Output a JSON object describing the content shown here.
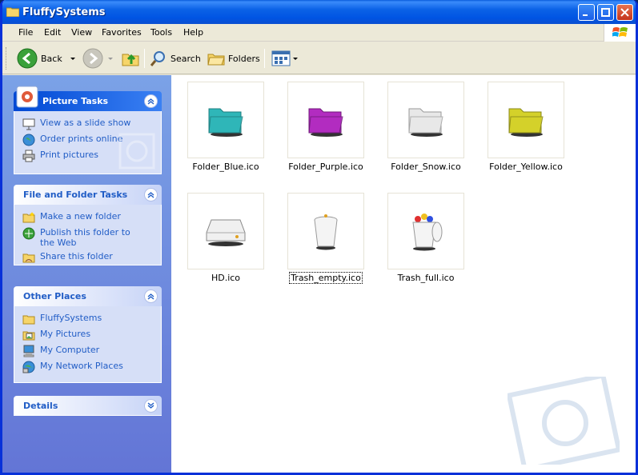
{
  "window": {
    "title": "FluffySystems"
  },
  "menu": [
    "File",
    "Edit",
    "View",
    "Favorites",
    "Tools",
    "Help"
  ],
  "toolbar": {
    "back_label": "Back",
    "search_label": "Search",
    "folders_label": "Folders"
  },
  "panels": {
    "picture_tasks": {
      "title": "Picture Tasks",
      "items": [
        "View as a slide show",
        "Order prints online",
        "Print pictures"
      ]
    },
    "file_folder_tasks": {
      "title": "File and Folder Tasks",
      "items": [
        "Make a new folder",
        "Publish this folder to the Web",
        "Share this folder"
      ]
    },
    "other_places": {
      "title": "Other Places",
      "items": [
        "FluffySystems",
        "My Pictures",
        "My Computer",
        "My Network Places"
      ]
    },
    "details": {
      "title": "Details"
    }
  },
  "files": [
    {
      "name": "Folder_Blue.ico",
      "color": "#2fb6b8"
    },
    {
      "name": "Folder_Purple.ico",
      "color": "#b22cc0"
    },
    {
      "name": "Folder_Snow.ico",
      "color": "#e8e8e8"
    },
    {
      "name": "Folder_Yellow.ico",
      "color": "#d4d12a"
    },
    {
      "name": "HD.ico",
      "color": "#f0f0f0"
    },
    {
      "name": "Trash_empty.ico",
      "color": "#f4f4f4"
    },
    {
      "name": "Trash_full.ico",
      "color": "#f4f4f4"
    }
  ],
  "colors": {
    "titlebar": "#0054e3",
    "task_link": "#215dc6",
    "left_pane": "#7ba2e7"
  }
}
